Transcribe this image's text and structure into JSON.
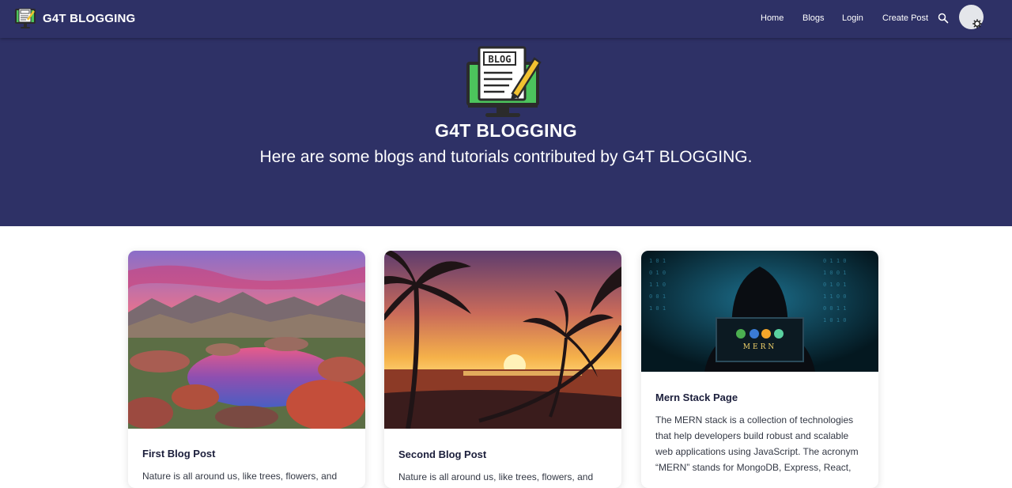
{
  "navbar": {
    "brand": "G4T BLOGGING",
    "links": {
      "home": "Home",
      "blogs": "Blogs",
      "login": "Login",
      "create_post": "Create Post"
    },
    "icons": {
      "logo": "blog-monitor-logo",
      "search": "search-icon",
      "avatar": "user-avatar",
      "badge": "gear-icon"
    }
  },
  "hero": {
    "title": "G4T BLOGGING",
    "subtitle": "Here are some blogs and tutorials contributed by G4T BLOGGING."
  },
  "cards": [
    {
      "title": "First Blog Post",
      "text": "Nature is all around us, like trees, flowers, and"
    },
    {
      "title": "Second Blog Post",
      "text": "Nature is all around us, like trees, flowers, and"
    },
    {
      "title": "Mern Stack Page",
      "text": "The MERN stack is a collection of technologies that help developers build robust and scalable web applications using JavaScript. The acronym “MERN” stands for MongoDB, Express, React,",
      "image_text": "MERN"
    }
  ],
  "colors": {
    "header_bg": "#2e3166",
    "text_dark": "#1b1e3b"
  }
}
